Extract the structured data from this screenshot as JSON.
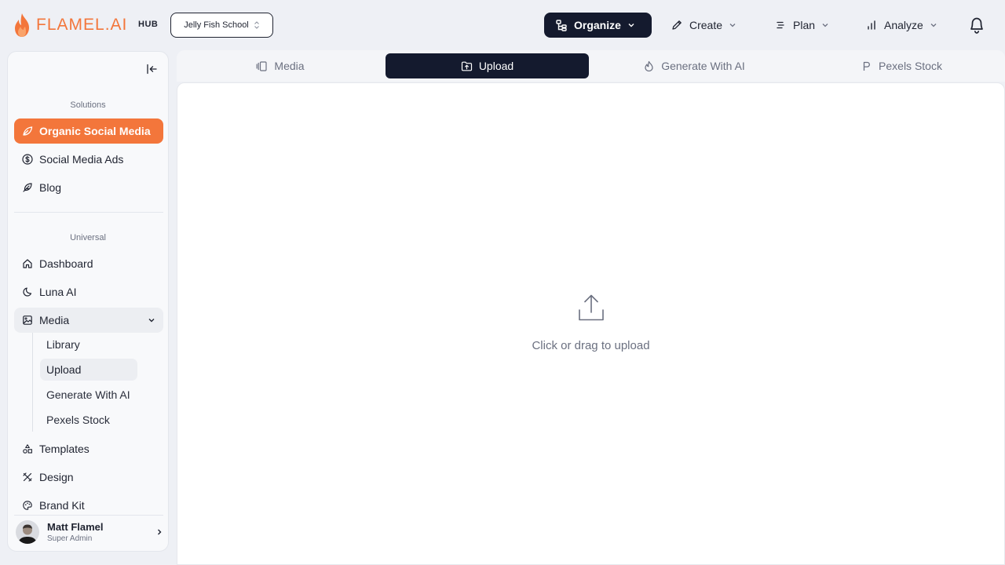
{
  "brand": {
    "name": "FLAMEL.AI",
    "hub": "HUB",
    "accent": "#f3763b",
    "dark": "#141a2e"
  },
  "workspace": {
    "selected": "Jelly Fish School"
  },
  "topnav": [
    {
      "label": "Organize",
      "icon": "organize-icon",
      "active": true
    },
    {
      "label": "Create",
      "icon": "pencil-icon",
      "active": false
    },
    {
      "label": "Plan",
      "icon": "list-icon",
      "active": false
    },
    {
      "label": "Analyze",
      "icon": "bar-chart-icon",
      "active": false
    }
  ],
  "sidebar": {
    "solutions_label": "Solutions",
    "solutions": [
      {
        "label": "Organic Social Media",
        "icon": "leaf-icon",
        "active": true
      },
      {
        "label": "Social Media Ads",
        "icon": "dollar-icon",
        "active": false
      },
      {
        "label": "Blog",
        "icon": "feather-icon",
        "active": false
      }
    ],
    "universal_label": "Universal",
    "universal": [
      {
        "label": "Dashboard",
        "icon": "home-icon"
      },
      {
        "label": "Luna AI",
        "icon": "moon-icon"
      },
      {
        "label": "Media",
        "icon": "image-icon",
        "expanded": true
      },
      {
        "label": "Templates",
        "icon": "shapes-icon"
      },
      {
        "label": "Design",
        "icon": "design-icon"
      },
      {
        "label": "Brand Kit",
        "icon": "palette-icon"
      }
    ],
    "media_sub": [
      {
        "label": "Library",
        "current": false
      },
      {
        "label": "Upload",
        "current": true
      },
      {
        "label": "Generate With AI",
        "current": false
      },
      {
        "label": "Pexels Stock",
        "current": false
      }
    ],
    "user": {
      "name": "Matt Flamel",
      "role": "Super Admin"
    }
  },
  "tabs": [
    {
      "label": "Media",
      "icon": "gallery-icon",
      "active": false
    },
    {
      "label": "Upload",
      "icon": "upload-folder-icon",
      "active": true
    },
    {
      "label": "Generate With AI",
      "icon": "flame-icon",
      "active": false
    },
    {
      "label": "Pexels Stock",
      "icon": "pexels-icon",
      "active": false
    }
  ],
  "upload": {
    "prompt": "Click or drag to upload"
  }
}
